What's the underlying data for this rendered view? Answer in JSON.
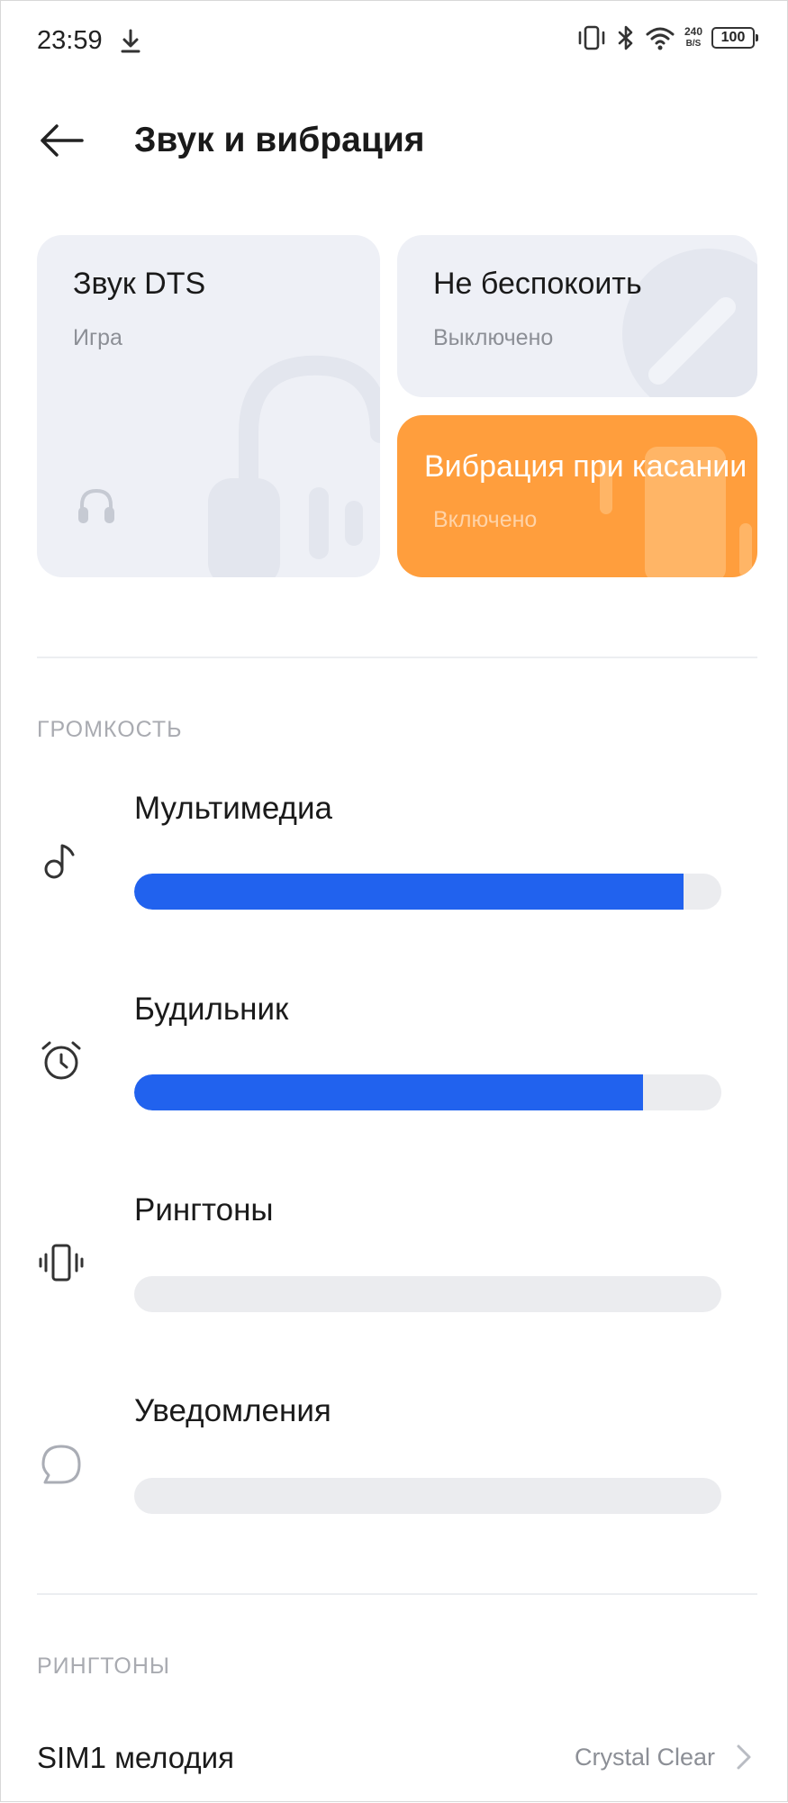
{
  "status_bar": {
    "time": "23:59",
    "speed_value": "240",
    "speed_unit": "B/S",
    "battery": "100"
  },
  "header": {
    "title": "Звук и вибрация"
  },
  "tiles": {
    "dts": {
      "title": "Звук DTS",
      "subtitle": "Игра"
    },
    "dnd": {
      "title": "Не беспокоить",
      "subtitle": "Выключено"
    },
    "vibration": {
      "title": "Вибрация при касании",
      "subtitle": "Включено",
      "accent": "#ff9e3d"
    }
  },
  "volume": {
    "header": "ГРОМКОСТЬ",
    "accent": "#2162ee",
    "items": [
      {
        "label": "Мультимедиа",
        "icon": "music-note-icon",
        "level": 0.935
      },
      {
        "label": "Будильник",
        "icon": "alarm-clock-icon",
        "level": 0.867
      },
      {
        "label": "Рингтоны",
        "icon": "vibrate-phone-icon",
        "level": 0.0
      },
      {
        "label": "Уведомления",
        "icon": "chat-bubble-icon",
        "level": 0.0
      }
    ]
  },
  "ringtones": {
    "header": "РИНГТОНЫ",
    "sim1_label": "SIM1 мелодия",
    "sim1_value": "Crystal Clear"
  }
}
